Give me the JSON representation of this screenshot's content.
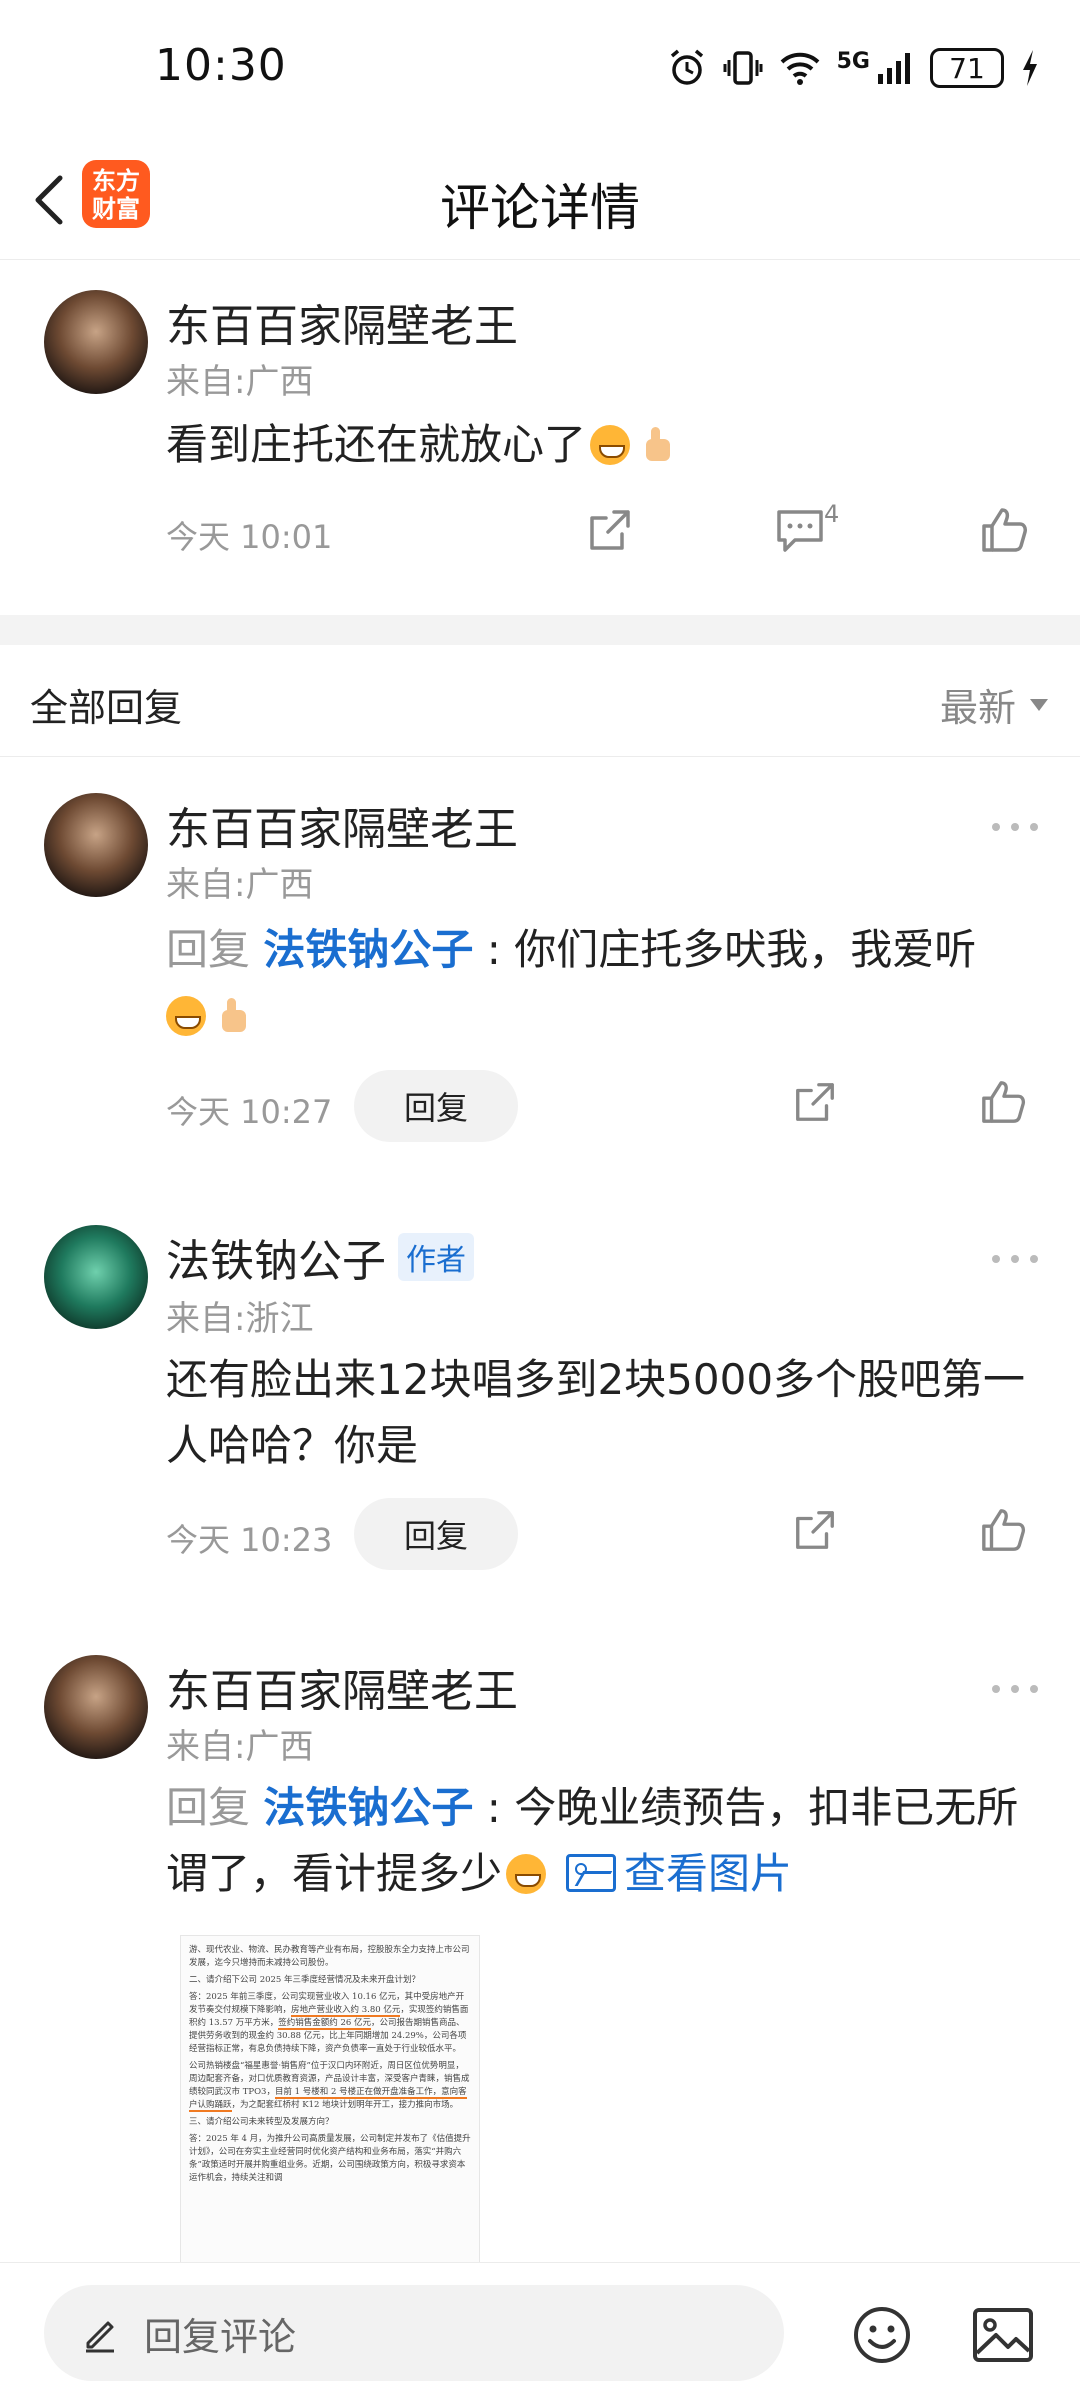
{
  "status_bar": {
    "time": "10:30",
    "network": "5G",
    "battery": "71"
  },
  "header": {
    "title": "评论详情",
    "app_logo_text": "东方财富",
    "app_logo_color": "#ff5a1f"
  },
  "main_comment": {
    "author": "东百百家隔壁老王",
    "location": "来自:广西",
    "text": "看到庄托还在就放心了",
    "time": "今天 10:01",
    "comment_count": "4"
  },
  "replies": {
    "title": "全部回复",
    "sort": "最新",
    "reply_button_label": "回复",
    "reply_prefix": "回复",
    "items": [
      {
        "author": "东百百家隔壁老王",
        "location": "来自:广西",
        "mention": "法铁钠公子",
        "text": " : 你们庄托多吠我，我爱听",
        "time": "今天 10:27"
      },
      {
        "author": "法铁钠公子",
        "author_tag": "作者",
        "location": "来自:浙江",
        "text": "还有脸出来12块唱多到2块5000多个股吧第一人哈哈？你是",
        "time": "今天 10:23"
      },
      {
        "author": "东百百家隔壁老王",
        "location": "来自:广西",
        "mention": "法铁钠公子",
        "text": " : 今晚业绩预告，扣非已无所谓了，看计提多少",
        "view_image": "查看图片"
      }
    ]
  },
  "doc_image": {
    "lines": [
      "游、现代农业、物流、民办教育等产业有布局，控股股东全力支持上市公司发展，迄今只增持而未减持公司股份。",
      "二、请介绍下公司 2025 年三季度经营情况及未来开盘计划？",
      "答：2025 年前三季度，公司实现营业收入 10.16 亿元，其中受房地产开发节奏交付规模下降影响，",
      "房地产营业收入约 3.80 亿元",
      "，实现签约销售面积约 13.57 万平方米，",
      "签约销售金额约 26 亿元",
      "，公司报告期销售商品、提供劳务收到的现金约 30.88 亿元，比上年同期增加 24.29%，公司各项经营指标正常，有息负债持续下降，资产负债率一直处于行业较低水平。",
      "公司热销楼盘“福星惠誉·销售府”位于汉口内环附近，周日区位优势明显，周边配套齐备，对口优质教育资源，产品设计丰富，深受客户青睐，销售成绩较同武汉市 TPO3，",
      "目前 1 号楼和 2 号楼正在做开盘准备工作，意向客户认购踊跃",
      "，为之配套红桥村 K12 地块计划明年开工，接力推向市场。",
      "三、请介绍公司未来转型及发展方向？",
      "答：2025 年 4 月，为推升公司高质量发展，公司制定并发布了《估值提升计划》，公司在夯实主业经营同时优化资产结构和业务布局，落实“并购六条”政策适时开展并购重组业务。近期，公司围绕政策方向，积极寻求资本运作机会，持续关注和调"
    ]
  },
  "bottom_bar": {
    "input_placeholder": "回复评论"
  }
}
